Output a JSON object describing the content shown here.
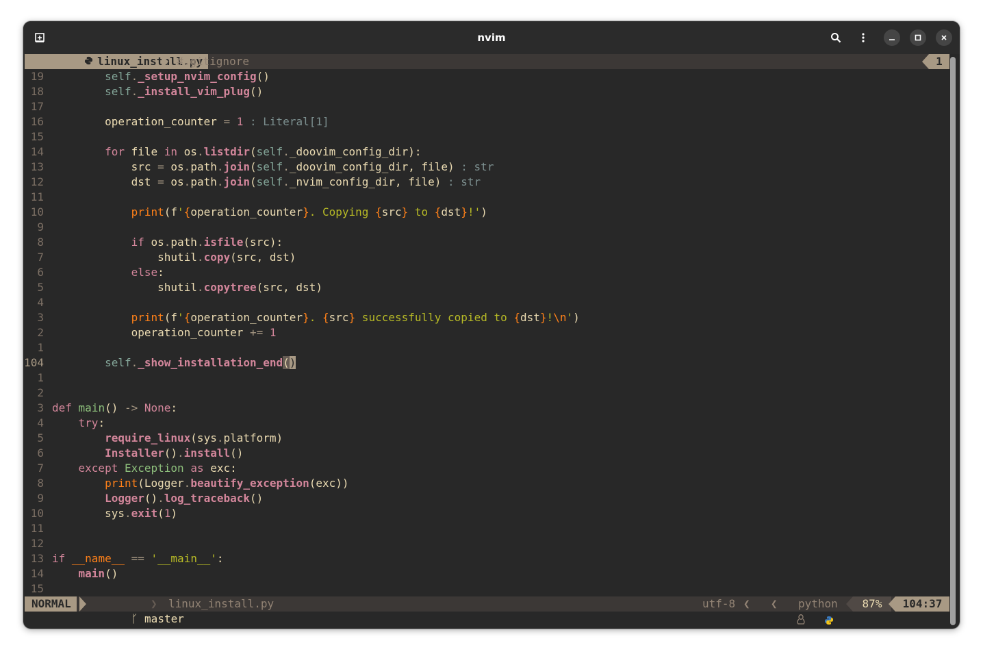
{
  "window": {
    "title": "nvim"
  },
  "tabline": {
    "active_tab": "linux_install.py",
    "inactive_tab": "#.gitignore",
    "tab_count": "1"
  },
  "status": {
    "mode": "NORMAL",
    "branch": "master",
    "file": "linux_install.py",
    "encoding": "utf-8",
    "filetype": "python",
    "percent": "87%",
    "position": "104:37"
  },
  "lines": [
    {
      "n": "19",
      "t": "        self._setup_nvim_config()"
    },
    {
      "n": "18",
      "t": "        self._install_vim_plug()"
    },
    {
      "n": "17",
      "t": ""
    },
    {
      "n": "16",
      "t": "        operation_counter = 1 : Literal[1]"
    },
    {
      "n": "15",
      "t": ""
    },
    {
      "n": "14",
      "t": "        for file in os.listdir(self._doovim_config_dir):"
    },
    {
      "n": "13",
      "t": "            src = os.path.join(self._doovim_config_dir, file) : str"
    },
    {
      "n": "12",
      "t": "            dst = os.path.join(self._nvim_config_dir, file) : str"
    },
    {
      "n": "11",
      "t": ""
    },
    {
      "n": "10",
      "t": "            print(f'{operation_counter}. Copying {src} to {dst}!')"
    },
    {
      "n": "9",
      "t": ""
    },
    {
      "n": "8",
      "t": "            if os.path.isfile(src):"
    },
    {
      "n": "7",
      "t": "                shutil.copy(src, dst)"
    },
    {
      "n": "6",
      "t": "            else:"
    },
    {
      "n": "5",
      "t": "                shutil.copytree(src, dst)"
    },
    {
      "n": "4",
      "t": ""
    },
    {
      "n": "3",
      "t": "            print(f'{operation_counter}. {src} successfully copied to {dst}!\\n')"
    },
    {
      "n": "2",
      "t": "            operation_counter += 1"
    },
    {
      "n": "1",
      "t": ""
    },
    {
      "n": "104",
      "t": "        self._show_installation_end()"
    },
    {
      "n": "1",
      "t": ""
    },
    {
      "n": "2",
      "t": ""
    },
    {
      "n": "3",
      "t": "def main() -> None:"
    },
    {
      "n": "4",
      "t": "    try:"
    },
    {
      "n": "5",
      "t": "        require_linux(sys.platform)"
    },
    {
      "n": "6",
      "t": "        Installer().install()"
    },
    {
      "n": "7",
      "t": "    except Exception as exc:"
    },
    {
      "n": "8",
      "t": "        print(Logger.beautify_exception(exc))"
    },
    {
      "n": "9",
      "t": "        Logger().log_traceback()"
    },
    {
      "n": "10",
      "t": "        sys.exit(1)"
    },
    {
      "n": "11",
      "t": ""
    },
    {
      "n": "12",
      "t": ""
    },
    {
      "n": "13",
      "t": "if __name__ == '__main__':"
    },
    {
      "n": "14",
      "t": "    main()"
    },
    {
      "n": "15",
      "t": ""
    }
  ],
  "icons": {
    "app": "terminal-icon",
    "search": "search-icon",
    "menu": "kebab-menu-icon",
    "minimize": "minimize-icon",
    "maximize": "maximize-icon",
    "close": "close-icon",
    "python": "python-icon",
    "branch": "git-branch-icon",
    "os": "linux-icon"
  },
  "colors": {
    "background": "#282828",
    "foreground": "#ebdbb2",
    "accent": "#a89984",
    "keyword": "#fb4934",
    "function": "#d3869b",
    "string": "#b8bb26",
    "builtin": "#fe8019",
    "self": "#83a598",
    "type": "#8ec07c"
  }
}
